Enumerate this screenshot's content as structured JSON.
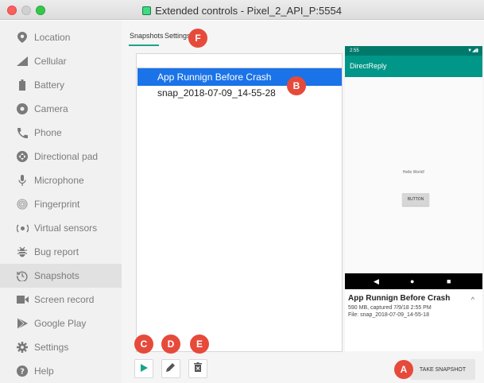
{
  "window": {
    "title": "Extended controls - Pixel_2_API_P:5554"
  },
  "sidebar": {
    "items": [
      {
        "label": "Location",
        "icon": "location-pin-icon"
      },
      {
        "label": "Cellular",
        "icon": "signal-icon"
      },
      {
        "label": "Battery",
        "icon": "battery-icon"
      },
      {
        "label": "Camera",
        "icon": "camera-icon"
      },
      {
        "label": "Phone",
        "icon": "phone-icon"
      },
      {
        "label": "Directional pad",
        "icon": "dpad-icon"
      },
      {
        "label": "Microphone",
        "icon": "microphone-icon"
      },
      {
        "label": "Fingerprint",
        "icon": "fingerprint-icon"
      },
      {
        "label": "Virtual sensors",
        "icon": "sensors-icon"
      },
      {
        "label": "Bug report",
        "icon": "bug-icon"
      },
      {
        "label": "Snapshots",
        "icon": "history-icon",
        "active": true
      },
      {
        "label": "Screen record",
        "icon": "video-camera-icon"
      },
      {
        "label": "Google Play",
        "icon": "google-play-icon"
      },
      {
        "label": "Settings",
        "icon": "gear-icon"
      },
      {
        "label": "Help",
        "icon": "help-icon"
      }
    ]
  },
  "tabs": {
    "snapshots": "Snapshots",
    "settings": "Settings"
  },
  "snapshots": {
    "items": [
      {
        "name": "App Runnign Before Crash",
        "selected": true
      },
      {
        "name": "snap_2018-07-09_14-55-28",
        "selected": false
      }
    ]
  },
  "preview": {
    "status_time": "2:55",
    "app_title": "DirectReply",
    "hello_text": "Hello World!",
    "button_label": "BUTTON",
    "nav_back": "◀",
    "nav_home": "●",
    "nav_recent": "■"
  },
  "info": {
    "title": "App Runnign Before Crash",
    "details": "590 MB, captured 7/9/18 2:55 PM",
    "file": "File: snap_2018-07-09_14-55-18"
  },
  "toolbar": {
    "take_snapshot": "TAKE SNAPSHOT"
  },
  "callouts": {
    "a": "A",
    "b": "B",
    "c": "C",
    "d": "D",
    "e": "E",
    "f": "F"
  },
  "colors": {
    "accent": "#1aa587",
    "selection": "#1a73e8",
    "callout": "#e64a3b",
    "app_bar": "#009688"
  }
}
